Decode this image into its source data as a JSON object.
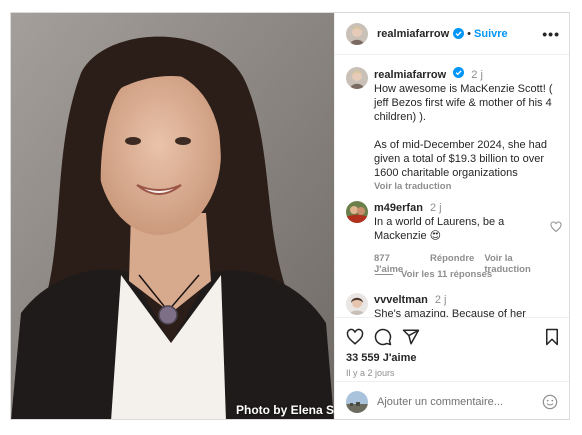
{
  "post": {
    "photo_credit": "Photo by Elena S",
    "author": "realmiafarrow",
    "follow_label": "Suivre",
    "more_label": "•••",
    "colors": {
      "accent": "#0095f6",
      "muted": "#8e8e8e",
      "text": "#262626"
    }
  },
  "caption": {
    "username": "realmiafarrow",
    "time": "2 j",
    "text": "How awesome is MacKenzie Scott! ( jeff Bezos first wife & mother of his 4 children) ).\n\n As of mid-December 2024,  she had given a total of $19.3 billion to over 1600 charitable organizations",
    "translate": "Voir la traduction"
  },
  "comments": [
    {
      "username": "m49erfan",
      "time": "2 j",
      "text": "In a world of Laurens, be a Mackenzie 😍",
      "likes": "877 J'aime",
      "reply": "Répondre",
      "translate": "Voir la traduction",
      "replies": "Voir les 11 réponses"
    },
    {
      "username": "vvveltman",
      "time": "2 j",
      "text": "She's amazing. Because of her"
    }
  ],
  "actions": {
    "like_icon": "heart-icon",
    "comment_icon": "comment-icon",
    "share_icon": "share-icon",
    "save_icon": "bookmark-icon",
    "likes_count": "33 559 J'aime",
    "posted_ago": "Il y a 2 jours"
  },
  "add_comment": {
    "placeholder": "Ajouter un commentaire..."
  }
}
